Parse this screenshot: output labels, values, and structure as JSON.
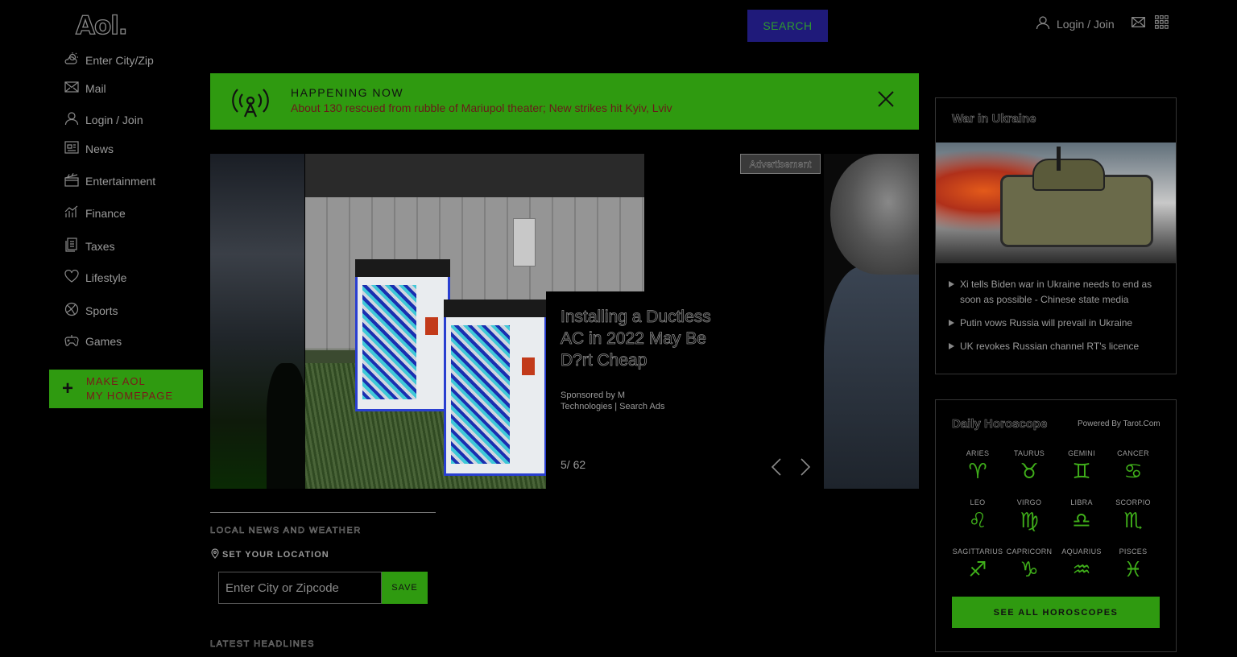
{
  "header": {
    "logo": "Aol.",
    "search_placeholder": "",
    "search_button": "SEARCH",
    "login_label": "Login / Join"
  },
  "sidebar": {
    "items": [
      {
        "label": "Enter City/Zip",
        "icon": "weather-icon"
      },
      {
        "label": "Mail",
        "icon": "mail-icon"
      },
      {
        "label": "Login / Join",
        "icon": "user-icon"
      },
      {
        "label": "News",
        "icon": "news-icon"
      },
      {
        "label": "Entertainment",
        "icon": "clapperboard-icon"
      },
      {
        "label": "Finance",
        "icon": "chart-icon"
      },
      {
        "label": "Taxes",
        "icon": "document-icon"
      },
      {
        "label": "Lifestyle",
        "icon": "heart-icon"
      },
      {
        "label": "Sports",
        "icon": "ball-icon"
      },
      {
        "label": "Games",
        "icon": "gamepad-icon"
      }
    ],
    "make_homepage": {
      "line1": "MAKE AOL",
      "line2": "MY HOMEPAGE"
    }
  },
  "banner": {
    "title": "HAPPENING NOW",
    "text": "About 130 rescued from rubble of Mariupol theater; New strikes hit Kyiv, Lviv"
  },
  "slideshow": {
    "caption_title": "Installing a Ductless AC in 2022 May Be D?rt Cheap",
    "sponsor": "Sponsored by M Technologies | Search Ads",
    "counter": "5/ 62",
    "ad_label": "Advertisement"
  },
  "local": {
    "title": "LOCAL NEWS AND WEATHER",
    "set_location": "SET YOUR LOCATION",
    "input_placeholder": "Enter City or Zipcode",
    "save_button": "SAVE"
  },
  "latest_title": "LATEST HEADLINES",
  "war": {
    "title": "War in Ukraine",
    "headlines": [
      "Xi tells Biden war in Ukraine needs to end as soon as possible - Chinese state media",
      "Putin vows Russia will prevail in Ukraine",
      "UK revokes Russian channel RT's licence"
    ]
  },
  "horoscope": {
    "title": "Daily Horoscope",
    "powered_by": "Powered By Tarot.Com",
    "signs": [
      {
        "name": "ARIES",
        "glyph": "♈"
      },
      {
        "name": "TAURUS",
        "glyph": "♉"
      },
      {
        "name": "GEMINI",
        "glyph": "♊"
      },
      {
        "name": "CANCER",
        "glyph": "♋"
      },
      {
        "name": "LEO",
        "glyph": "♌"
      },
      {
        "name": "VIRGO",
        "glyph": "♍"
      },
      {
        "name": "LIBRA",
        "glyph": "♎"
      },
      {
        "name": "SCORPIO",
        "glyph": "♏"
      },
      {
        "name": "SAGITTARIUS",
        "glyph": "♐"
      },
      {
        "name": "CAPRICORN",
        "glyph": "♑"
      },
      {
        "name": "AQUARIUS",
        "glyph": "♒"
      },
      {
        "name": "PISCES",
        "glyph": "♓"
      }
    ],
    "button": "SEE ALL HOROSCOPES"
  },
  "colors": {
    "accent_green": "#2f9a10",
    "search_button": "#1f1a7a",
    "banner_text": "#6a1a1a"
  }
}
